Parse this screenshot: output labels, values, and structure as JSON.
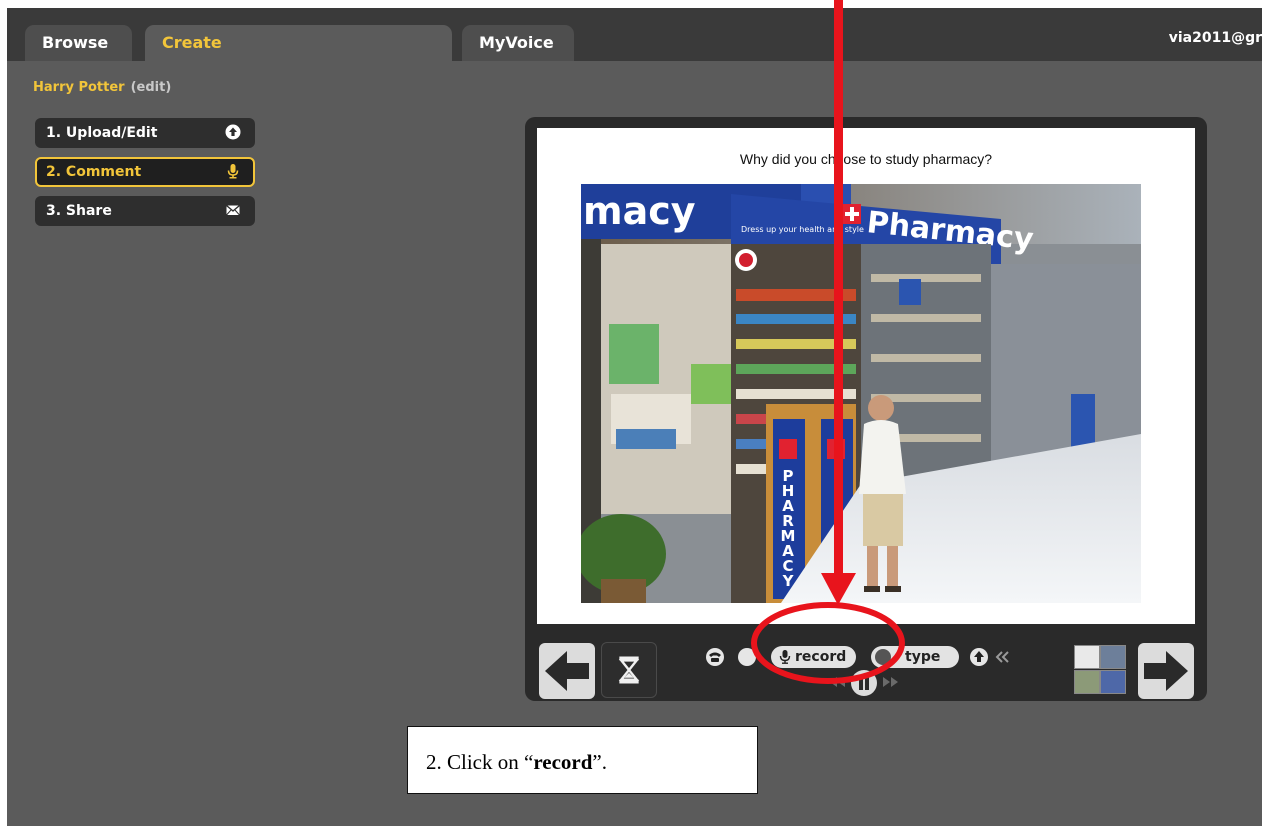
{
  "tabs": [
    {
      "label": "Browse",
      "active": false
    },
    {
      "label": "Create",
      "active": true
    },
    {
      "label": "MyVoice",
      "active": false
    }
  ],
  "user": {
    "label": "via2011@gr"
  },
  "project": {
    "title": "Harry Potter",
    "edit_label": "(edit)"
  },
  "steps": [
    {
      "label": "1. Upload/Edit",
      "icon": "upload-icon",
      "active": false
    },
    {
      "label": "2. Comment",
      "icon": "microphone-icon",
      "active": true
    },
    {
      "label": "3. Share",
      "icon": "envelope-icon",
      "active": false
    }
  ],
  "slide": {
    "question": "Why did you choose to study pharmacy?",
    "photo": {
      "sign_text": "Pharmacy",
      "banner_text": "macy",
      "column_text": "PHARMACY",
      "tagline": "Dress up your health and style"
    }
  },
  "controls": {
    "record_label": "record",
    "type_label": "type",
    "prev_icon": "arrow-left-icon",
    "next_icon": "arrow-right-icon",
    "timer_icon": "hourglass-icon",
    "phone_icon": "phone-icon",
    "upload_icon": "upload-icon",
    "rewind_icon": "double-chevron-left-icon",
    "pause_icon": "pause-icon"
  },
  "instruction": {
    "prefix": "2. Click on “",
    "keyword": "record",
    "suffix": "”."
  },
  "colors": {
    "accent": "#f2c53a",
    "annotation": "#e8141c",
    "panel": "#5b5b5b",
    "topbar": "#3a3a3a"
  }
}
